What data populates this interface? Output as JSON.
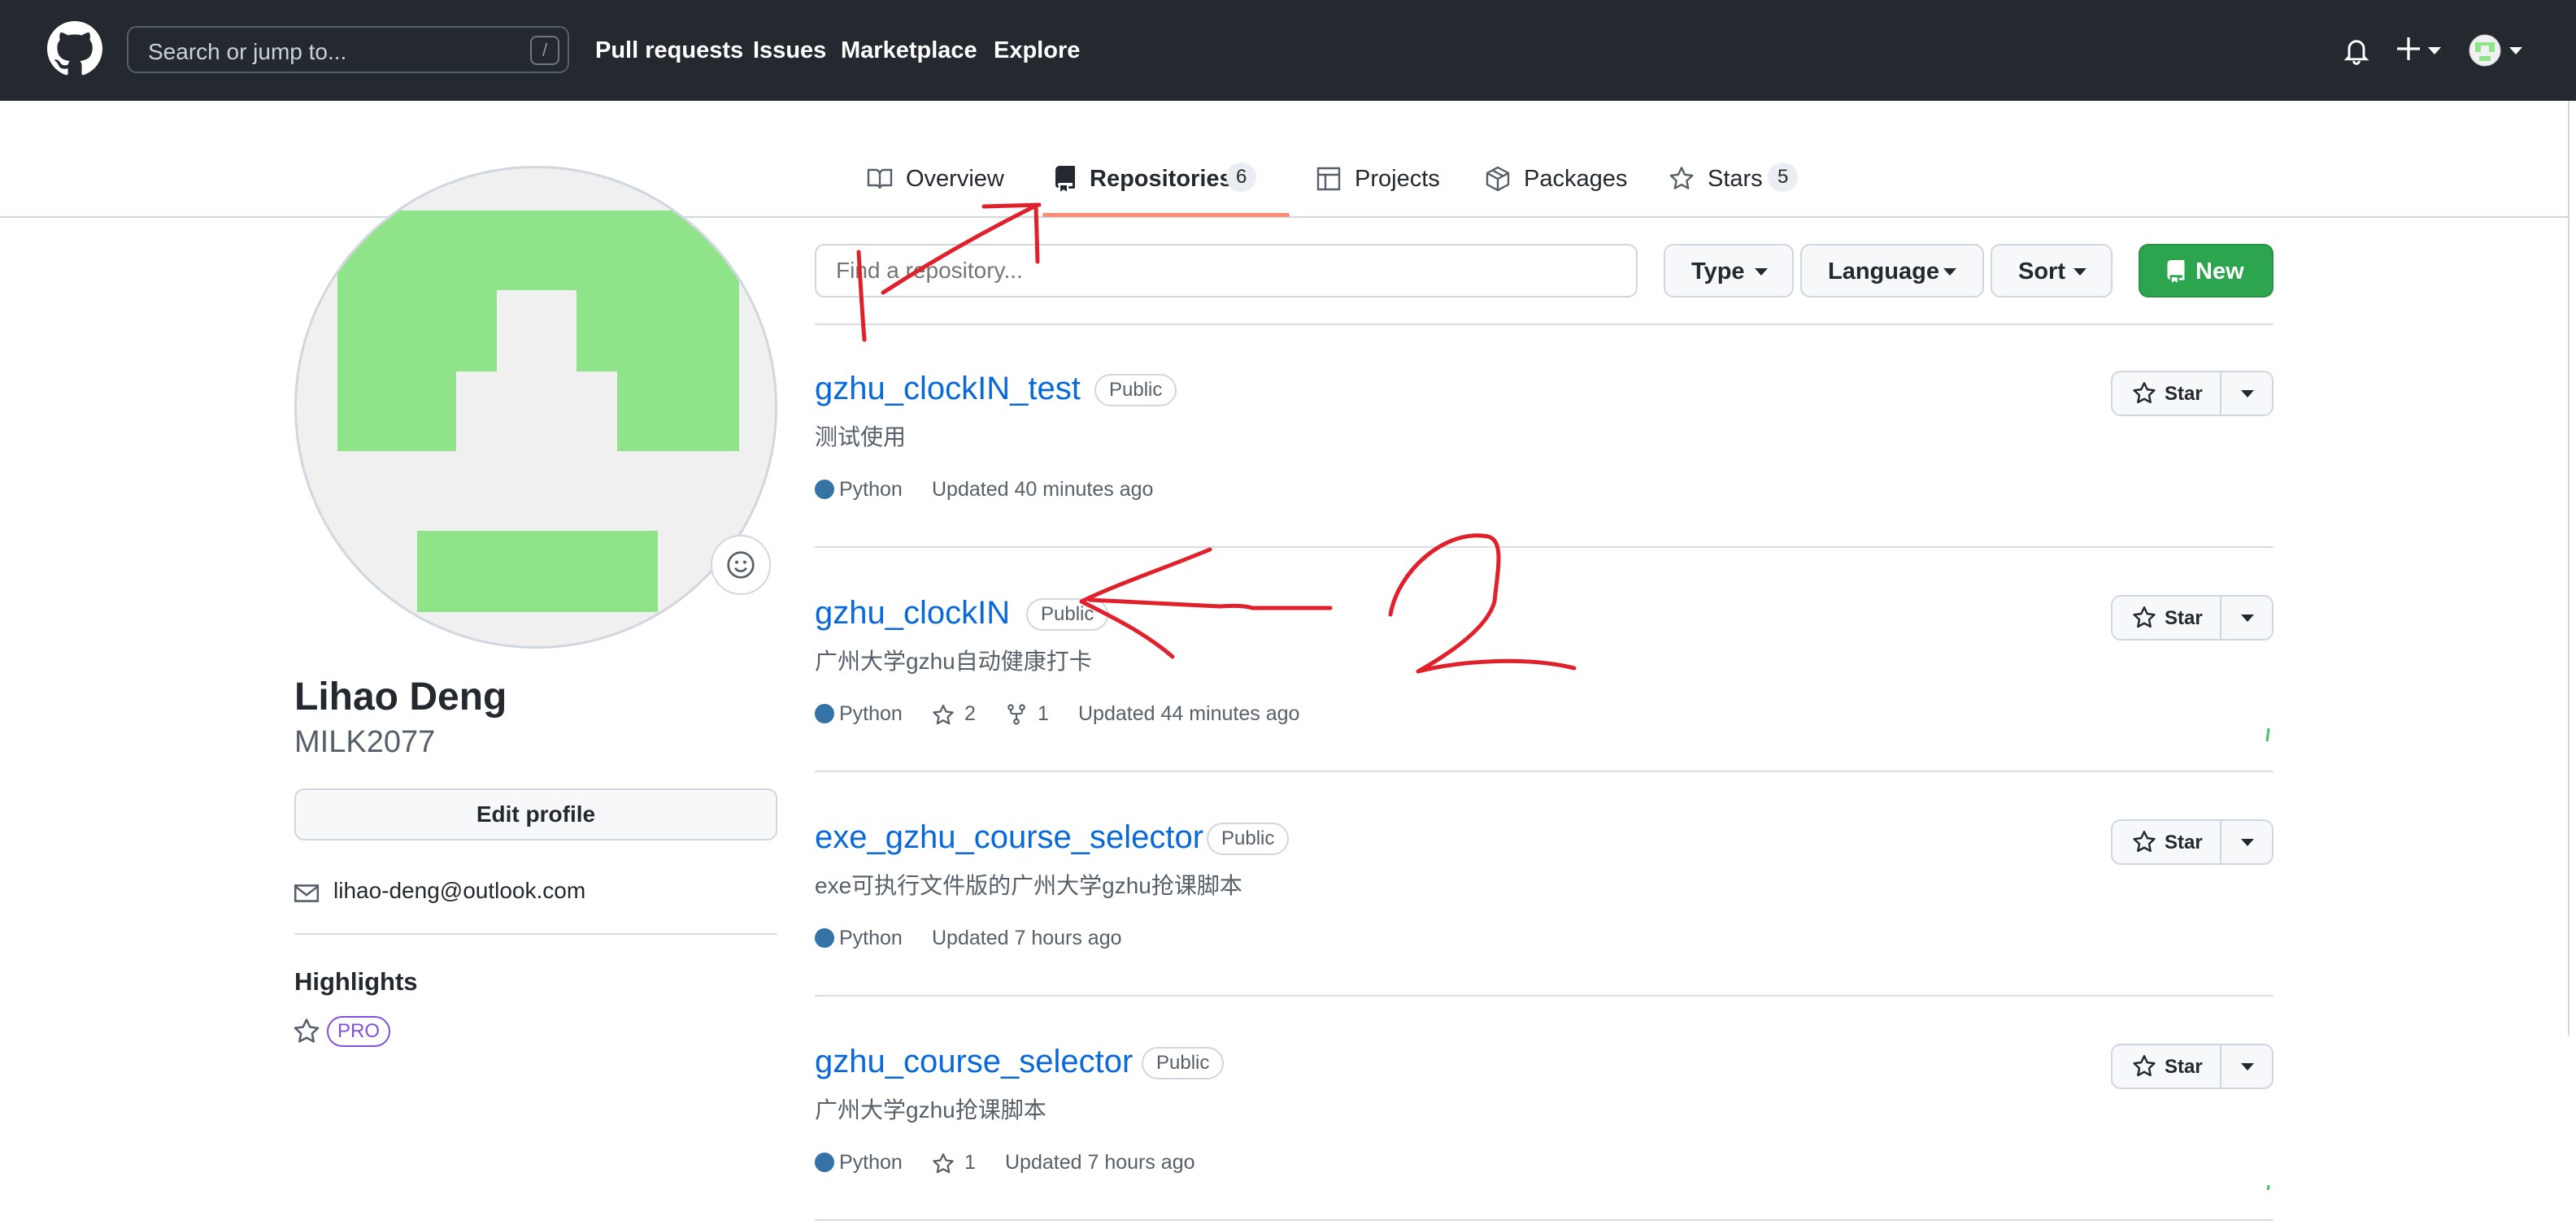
{
  "header": {
    "search_placeholder": "Search or jump to...",
    "search_shortcut": "/",
    "nav": [
      "Pull requests",
      "Issues",
      "Marketplace",
      "Explore"
    ]
  },
  "tabs": [
    {
      "label": "Overview",
      "icon": "book-icon"
    },
    {
      "label": "Repositories",
      "icon": "repo-icon",
      "count": "6",
      "selected": true
    },
    {
      "label": "Projects",
      "icon": "table-icon"
    },
    {
      "label": "Packages",
      "icon": "package-icon"
    },
    {
      "label": "Stars",
      "icon": "star-icon",
      "count": "5"
    }
  ],
  "profile": {
    "name": "Lihao Deng",
    "username": "MILK2077",
    "edit_label": "Edit profile",
    "email": "lihao-deng@outlook.com",
    "highlights_title": "Highlights",
    "pro_badge": "PRO"
  },
  "toolbar": {
    "find_placeholder": "Find a repository...",
    "type_label": "Type",
    "language_label": "Language",
    "sort_label": "Sort",
    "new_label": "New"
  },
  "repos": [
    {
      "name": "gzhu_clockIN_test",
      "visibility": "Public",
      "description": "测试使用",
      "language": "Python",
      "stars": "",
      "forks": "",
      "updated": "Updated 40 minutes ago",
      "star_label": "Star"
    },
    {
      "name": "gzhu_clockIN",
      "visibility": "Public",
      "description": "广州大学gzhu自动健康打卡",
      "language": "Python",
      "stars": "2",
      "forks": "1",
      "updated": "Updated 44 minutes ago",
      "star_label": "Star"
    },
    {
      "name": "exe_gzhu_course_selector",
      "visibility": "Public",
      "description": "exe可执行文件版的广州大学gzhu抢课脚本",
      "language": "Python",
      "stars": "",
      "forks": "",
      "updated": "Updated 7 hours ago",
      "star_label": "Star"
    },
    {
      "name": "gzhu_course_selector",
      "visibility": "Public",
      "description": "广州大学gzhu抢课脚本",
      "language": "Python",
      "stars": "1",
      "forks": "",
      "updated": "Updated 7 hours ago",
      "star_label": "Star"
    }
  ],
  "annotations": [
    "1",
    "2"
  ],
  "colors": {
    "header_bg": "#24292f",
    "link": "#0969da",
    "green_button": "#2da44e",
    "python": "#3572A5",
    "tab_underline": "#fd8c73",
    "annotation_red": "#e0202a",
    "avatar_green": "#8fe388"
  }
}
